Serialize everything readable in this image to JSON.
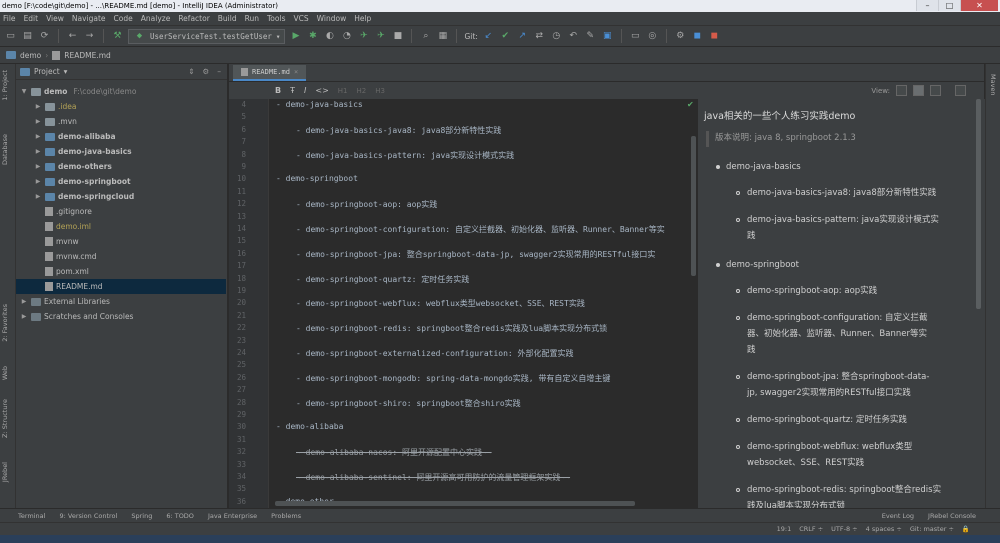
{
  "window": {
    "title": "demo [F:\\code\\git\\demo] - ...\\README.md [demo] - IntelliJ IDEA (Administrator)"
  },
  "menu": [
    "File",
    "Edit",
    "View",
    "Navigate",
    "Code",
    "Analyze",
    "Refactor",
    "Build",
    "Run",
    "Tools",
    "VCS",
    "Window",
    "Help"
  ],
  "toolbar": {
    "run_config": "UserServiceTest.testGetUser",
    "git_label": "Git:"
  },
  "navbar": {
    "project": "demo",
    "file": "README.md"
  },
  "left_tabs": {
    "project": "1: Project",
    "database": "Database",
    "favorites": "2: Favorites",
    "web": "Web",
    "structure": "Z: Structure",
    "jrebel": "JRebel"
  },
  "right_tabs": {
    "maven": "Maven"
  },
  "project_panel": {
    "title": "Project",
    "items": [
      {
        "label": "demo",
        "extra": "F:\\code\\git\\demo",
        "indent": 0,
        "kind": "folder",
        "open": true
      },
      {
        "label": ".idea",
        "indent": 1,
        "kind": "folder",
        "muted": true
      },
      {
        "label": ".mvn",
        "indent": 1,
        "kind": "folder"
      },
      {
        "label": "demo-alibaba",
        "indent": 1,
        "kind": "module"
      },
      {
        "label": "demo-java-basics",
        "indent": 1,
        "kind": "module"
      },
      {
        "label": "demo-others",
        "indent": 1,
        "kind": "module"
      },
      {
        "label": "demo-springboot",
        "indent": 1,
        "kind": "module"
      },
      {
        "label": "demo-springcloud",
        "indent": 1,
        "kind": "module"
      },
      {
        "label": ".gitignore",
        "indent": 1,
        "kind": "file"
      },
      {
        "label": "demo.iml",
        "indent": 1,
        "kind": "file",
        "muted": true
      },
      {
        "label": "mvnw",
        "indent": 1,
        "kind": "file"
      },
      {
        "label": "mvnw.cmd",
        "indent": 1,
        "kind": "file"
      },
      {
        "label": "pom.xml",
        "indent": 1,
        "kind": "file"
      },
      {
        "label": "README.md",
        "indent": 1,
        "kind": "file",
        "selected": true
      },
      {
        "label": "External Libraries",
        "indent": 0,
        "kind": "lib"
      },
      {
        "label": "Scratches and Consoles",
        "indent": 0,
        "kind": "lib"
      }
    ]
  },
  "editor": {
    "tab": "README.md",
    "md_toolbar": [
      "B",
      "Ŧ",
      "I",
      "<>",
      "H1",
      "H2",
      "H3"
    ],
    "view_label": "View:",
    "lines": [
      {
        "n": "4",
        "text": "- demo-java-basics",
        "indent": 0
      },
      {
        "n": "5",
        "text": "",
        "indent": 0
      },
      {
        "n": "6",
        "text": "- demo-java-basics-java8: java8部分新特性实践",
        "indent": 1
      },
      {
        "n": "7",
        "text": "",
        "indent": 0
      },
      {
        "n": "8",
        "text": "- demo-java-basics-pattern: java实现设计模式实践",
        "indent": 1
      },
      {
        "n": "9",
        "text": "",
        "indent": 0
      },
      {
        "n": "10",
        "text": "- demo-springboot",
        "indent": 0
      },
      {
        "n": "11",
        "text": "",
        "indent": 0
      },
      {
        "n": "12",
        "text": "- demo-springboot-aop: aop实践",
        "indent": 1
      },
      {
        "n": "13",
        "text": "",
        "indent": 0
      },
      {
        "n": "14",
        "text": "- demo-springboot-configuration: 自定义拦截器、初始化器、监听器、Runner、Banner等实",
        "indent": 1
      },
      {
        "n": "15",
        "text": "",
        "indent": 0
      },
      {
        "n": "16",
        "text": "- demo-springboot-jpa: 整合springboot-data-jp, swagger2实现常用的RESTful接口实",
        "indent": 1
      },
      {
        "n": "17",
        "text": "",
        "indent": 0
      },
      {
        "n": "18",
        "text": "- demo-springboot-quartz: 定时任务实践",
        "indent": 1
      },
      {
        "n": "19",
        "text": "",
        "indent": 0
      },
      {
        "n": "20",
        "text": "- demo-springboot-webflux: webflux类型websocket、SSE、REST实践",
        "indent": 1
      },
      {
        "n": "21",
        "text": "",
        "indent": 0
      },
      {
        "n": "22",
        "text": "- demo-springboot-redis: springboot整合redis实践及lua脚本实现分布式锁",
        "indent": 1
      },
      {
        "n": "23",
        "text": "",
        "indent": 0
      },
      {
        "n": "24",
        "text": "- demo-springboot-externalized-configuration: 外部化配置实践",
        "indent": 1
      },
      {
        "n": "25",
        "text": "",
        "indent": 0
      },
      {
        "n": "26",
        "text": "- demo-springboot-mongodb: spring-data-mongdo实践, 带有自定义自增主键",
        "indent": 1
      },
      {
        "n": "27",
        "text": "",
        "indent": 0
      },
      {
        "n": "28",
        "text": "- demo-springboot-shiro: springboot整合shiro实践",
        "indent": 1
      },
      {
        "n": "29",
        "text": "",
        "indent": 0
      },
      {
        "n": "30",
        "text": "- demo-alibaba",
        "indent": 0
      },
      {
        "n": "31",
        "text": "",
        "indent": 0
      },
      {
        "n": "32",
        "text": "~~demo-alibaba-nacos: 阿里开源配置中心实践~~",
        "indent": 1,
        "strike": true
      },
      {
        "n": "33",
        "text": "",
        "indent": 0
      },
      {
        "n": "34",
        "text": "~~demo-alibaba-sentinel: 阿里开源高可用防护的流量管理框架实践~~",
        "indent": 1,
        "strike": true
      },
      {
        "n": "35",
        "text": "",
        "indent": 0
      },
      {
        "n": "36",
        "text": "- demo-other",
        "indent": 0
      }
    ]
  },
  "preview": {
    "title": "java相关的一些个人练习实践demo",
    "quote": "版本说明: java 8, springboot 2.1.3",
    "sections": [
      {
        "label": "demo-java-basics",
        "children": [
          [
            "demo-java-basics-java8: java8部分新特性实践"
          ],
          [
            "demo-java-basics-pattern: java实现设计模式实",
            "践"
          ]
        ]
      },
      {
        "label": "demo-springboot",
        "children": [
          [
            "demo-springboot-aop: aop实践"
          ],
          [
            "demo-springboot-configuration: 自定义拦截",
            "器、初始化器、监听器、Runner、Banner等实",
            "践"
          ],
          [
            "demo-springboot-jpa: 整合springboot-data-",
            "jp, swagger2实现常用的RESTful接口实践"
          ],
          [
            "demo-springboot-quartz: 定时任务实践"
          ],
          [
            "demo-springboot-webflux: webflux类型",
            "websocket、SSE、REST实践"
          ],
          [
            "demo-springboot-redis: springboot整合redis实",
            "践及lua脚本实现分布式锁"
          ]
        ]
      }
    ]
  },
  "bottom_tabs": [
    "Terminal",
    "9: Version Control",
    "Spring",
    "6: TODO",
    "Java Enterprise",
    "Problems"
  ],
  "bottom_right_tabs": [
    "Event Log",
    "JRebel Console"
  ],
  "status": {
    "position": "19:1",
    "line_sep": "CRLF ÷",
    "encoding": "UTF-8 ÷",
    "indent": "4 spaces ÷",
    "git": "Git: master ÷"
  }
}
